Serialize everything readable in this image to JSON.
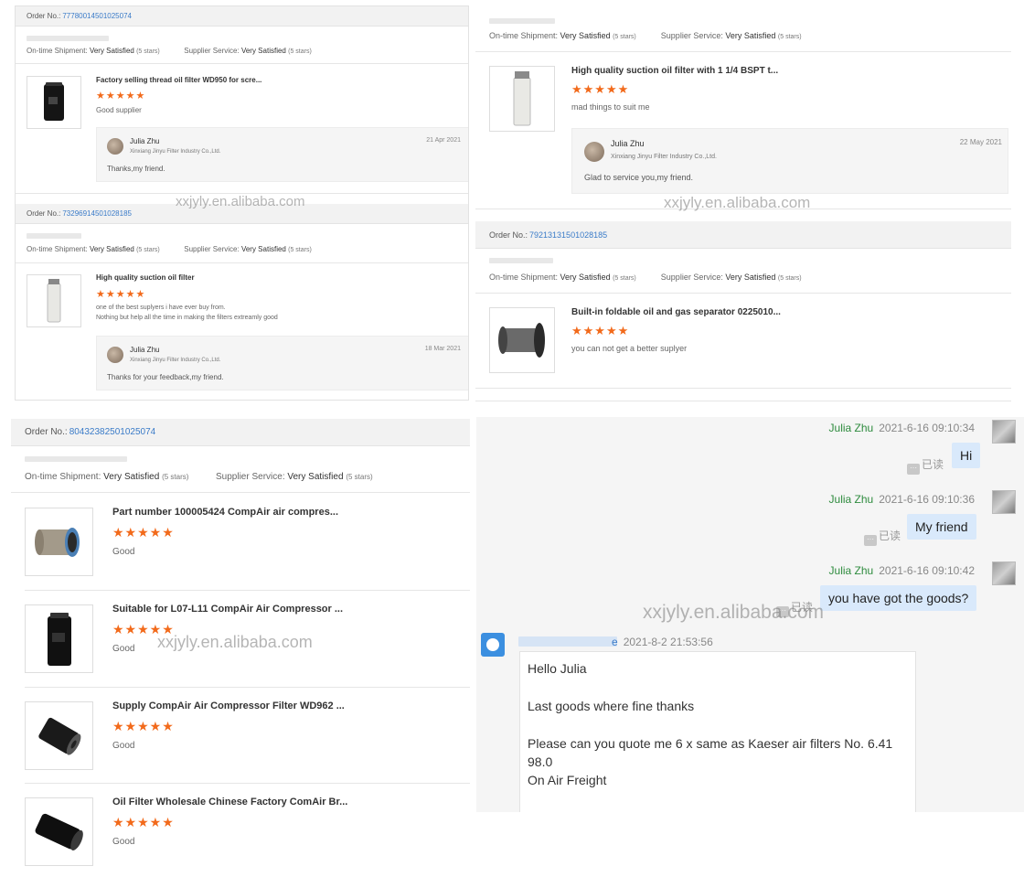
{
  "labels": {
    "order_no": "Order No.:",
    "ontime": "On-time Shipment:",
    "supplier": "Supplier Service:",
    "very_satisfied": "Very Satisfied",
    "five_stars": "(5 stars)",
    "stars": "★★★★★"
  },
  "watermark": "xxjyly.en.alibaba.com",
  "panel1": {
    "orders": [
      {
        "order_no": "77780014501025074",
        "product": "Factory selling thread oil filter WD950 for scre...",
        "review": "Good supplier",
        "reply": {
          "name": "Julia Zhu",
          "company": "Xinxiang Jinyu Filter Industry Co.,Ltd.",
          "date": "21 Apr 2021",
          "message": "Thanks,my friend."
        }
      },
      {
        "order_no": "73296914501028185",
        "product": "High quality suction oil filter",
        "review_line1": "one of the best suplyers i have ever buy from.",
        "review_line2": "Nothing but help all the time in making the filters extreamly good",
        "reply": {
          "name": "Julia Zhu",
          "company": "Xinxiang Jinyu Filter Industry Co.,Ltd.",
          "date": "18 Mar 2021",
          "message": "Thanks for your feedback,my friend."
        }
      }
    ]
  },
  "panel2": {
    "orders": [
      {
        "product": "High quality suction oil filter with 1 1/4 BSPT t...",
        "review": "mad things to suit me",
        "reply": {
          "name": "Julia Zhu",
          "company": "Xinxiang Jinyu Filter Industry Co.,Ltd.",
          "date": "22 May 2021",
          "message": "Glad to service you,my friend."
        }
      },
      {
        "order_no": "79213131501028185",
        "product": "Built-in foldable oil and gas separator 0225010...",
        "review": "you can not get a better suplyer"
      }
    ]
  },
  "panel3": {
    "order_no": "80432382501025074",
    "products": [
      {
        "title": "Part number 100005424 CompAir air compres...",
        "review": "Good"
      },
      {
        "title": "Suitable for L07-L11 CompAir Air Compressor ...",
        "review": "Good"
      },
      {
        "title": "Supply CompAir Air Compressor Filter WD962 ...",
        "review": "Good"
      },
      {
        "title": "Oil Filter Wholesale Chinese Factory ComAir Br...",
        "review": "Good"
      }
    ]
  },
  "chat": {
    "messages_out": [
      {
        "name": "Julia Zhu",
        "time": "2021-6-16 09:10:34",
        "text": "Hi",
        "read": "已读"
      },
      {
        "name": "Julia Zhu",
        "time": "2021-6-16 09:10:36",
        "text": "My friend",
        "read": "已读"
      },
      {
        "name": "Julia Zhu",
        "time": "2021-6-16 09:10:42",
        "text": "you have got the goods?",
        "read": "已读"
      }
    ],
    "incoming": {
      "name_tail": "e",
      "time": "2021-8-2 21:53:56",
      "line1": "Hello Julia",
      "line2": "Last goods where fine thanks",
      "line3": "Please can you quote me 6 x same as Kaeser air filters No. 6.41",
      "line4": "98.0",
      "line5": "On Air Freight"
    }
  }
}
